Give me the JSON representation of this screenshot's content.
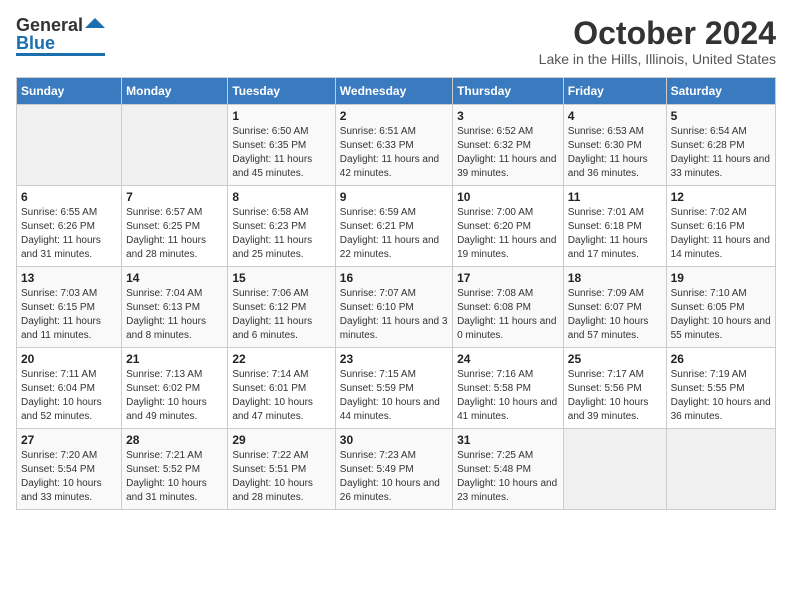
{
  "header": {
    "logo_general": "General",
    "logo_blue": "Blue",
    "month_title": "October 2024",
    "location": "Lake in the Hills, Illinois, United States"
  },
  "weekdays": [
    "Sunday",
    "Monday",
    "Tuesday",
    "Wednesday",
    "Thursday",
    "Friday",
    "Saturday"
  ],
  "weeks": [
    [
      {
        "day": null
      },
      {
        "day": null
      },
      {
        "day": "1",
        "sunrise": "6:50 AM",
        "sunset": "6:35 PM",
        "daylight": "11 hours and 45 minutes."
      },
      {
        "day": "2",
        "sunrise": "6:51 AM",
        "sunset": "6:33 PM",
        "daylight": "11 hours and 42 minutes."
      },
      {
        "day": "3",
        "sunrise": "6:52 AM",
        "sunset": "6:32 PM",
        "daylight": "11 hours and 39 minutes."
      },
      {
        "day": "4",
        "sunrise": "6:53 AM",
        "sunset": "6:30 PM",
        "daylight": "11 hours and 36 minutes."
      },
      {
        "day": "5",
        "sunrise": "6:54 AM",
        "sunset": "6:28 PM",
        "daylight": "11 hours and 33 minutes."
      }
    ],
    [
      {
        "day": "6",
        "sunrise": "6:55 AM",
        "sunset": "6:26 PM",
        "daylight": "11 hours and 31 minutes."
      },
      {
        "day": "7",
        "sunrise": "6:57 AM",
        "sunset": "6:25 PM",
        "daylight": "11 hours and 28 minutes."
      },
      {
        "day": "8",
        "sunrise": "6:58 AM",
        "sunset": "6:23 PM",
        "daylight": "11 hours and 25 minutes."
      },
      {
        "day": "9",
        "sunrise": "6:59 AM",
        "sunset": "6:21 PM",
        "daylight": "11 hours and 22 minutes."
      },
      {
        "day": "10",
        "sunrise": "7:00 AM",
        "sunset": "6:20 PM",
        "daylight": "11 hours and 19 minutes."
      },
      {
        "day": "11",
        "sunrise": "7:01 AM",
        "sunset": "6:18 PM",
        "daylight": "11 hours and 17 minutes."
      },
      {
        "day": "12",
        "sunrise": "7:02 AM",
        "sunset": "6:16 PM",
        "daylight": "11 hours and 14 minutes."
      }
    ],
    [
      {
        "day": "13",
        "sunrise": "7:03 AM",
        "sunset": "6:15 PM",
        "daylight": "11 hours and 11 minutes."
      },
      {
        "day": "14",
        "sunrise": "7:04 AM",
        "sunset": "6:13 PM",
        "daylight": "11 hours and 8 minutes."
      },
      {
        "day": "15",
        "sunrise": "7:06 AM",
        "sunset": "6:12 PM",
        "daylight": "11 hours and 6 minutes."
      },
      {
        "day": "16",
        "sunrise": "7:07 AM",
        "sunset": "6:10 PM",
        "daylight": "11 hours and 3 minutes."
      },
      {
        "day": "17",
        "sunrise": "7:08 AM",
        "sunset": "6:08 PM",
        "daylight": "11 hours and 0 minutes."
      },
      {
        "day": "18",
        "sunrise": "7:09 AM",
        "sunset": "6:07 PM",
        "daylight": "10 hours and 57 minutes."
      },
      {
        "day": "19",
        "sunrise": "7:10 AM",
        "sunset": "6:05 PM",
        "daylight": "10 hours and 55 minutes."
      }
    ],
    [
      {
        "day": "20",
        "sunrise": "7:11 AM",
        "sunset": "6:04 PM",
        "daylight": "10 hours and 52 minutes."
      },
      {
        "day": "21",
        "sunrise": "7:13 AM",
        "sunset": "6:02 PM",
        "daylight": "10 hours and 49 minutes."
      },
      {
        "day": "22",
        "sunrise": "7:14 AM",
        "sunset": "6:01 PM",
        "daylight": "10 hours and 47 minutes."
      },
      {
        "day": "23",
        "sunrise": "7:15 AM",
        "sunset": "5:59 PM",
        "daylight": "10 hours and 44 minutes."
      },
      {
        "day": "24",
        "sunrise": "7:16 AM",
        "sunset": "5:58 PM",
        "daylight": "10 hours and 41 minutes."
      },
      {
        "day": "25",
        "sunrise": "7:17 AM",
        "sunset": "5:56 PM",
        "daylight": "10 hours and 39 minutes."
      },
      {
        "day": "26",
        "sunrise": "7:19 AM",
        "sunset": "5:55 PM",
        "daylight": "10 hours and 36 minutes."
      }
    ],
    [
      {
        "day": "27",
        "sunrise": "7:20 AM",
        "sunset": "5:54 PM",
        "daylight": "10 hours and 33 minutes."
      },
      {
        "day": "28",
        "sunrise": "7:21 AM",
        "sunset": "5:52 PM",
        "daylight": "10 hours and 31 minutes."
      },
      {
        "day": "29",
        "sunrise": "7:22 AM",
        "sunset": "5:51 PM",
        "daylight": "10 hours and 28 minutes."
      },
      {
        "day": "30",
        "sunrise": "7:23 AM",
        "sunset": "5:49 PM",
        "daylight": "10 hours and 26 minutes."
      },
      {
        "day": "31",
        "sunrise": "7:25 AM",
        "sunset": "5:48 PM",
        "daylight": "10 hours and 23 minutes."
      },
      {
        "day": null
      },
      {
        "day": null
      }
    ]
  ]
}
